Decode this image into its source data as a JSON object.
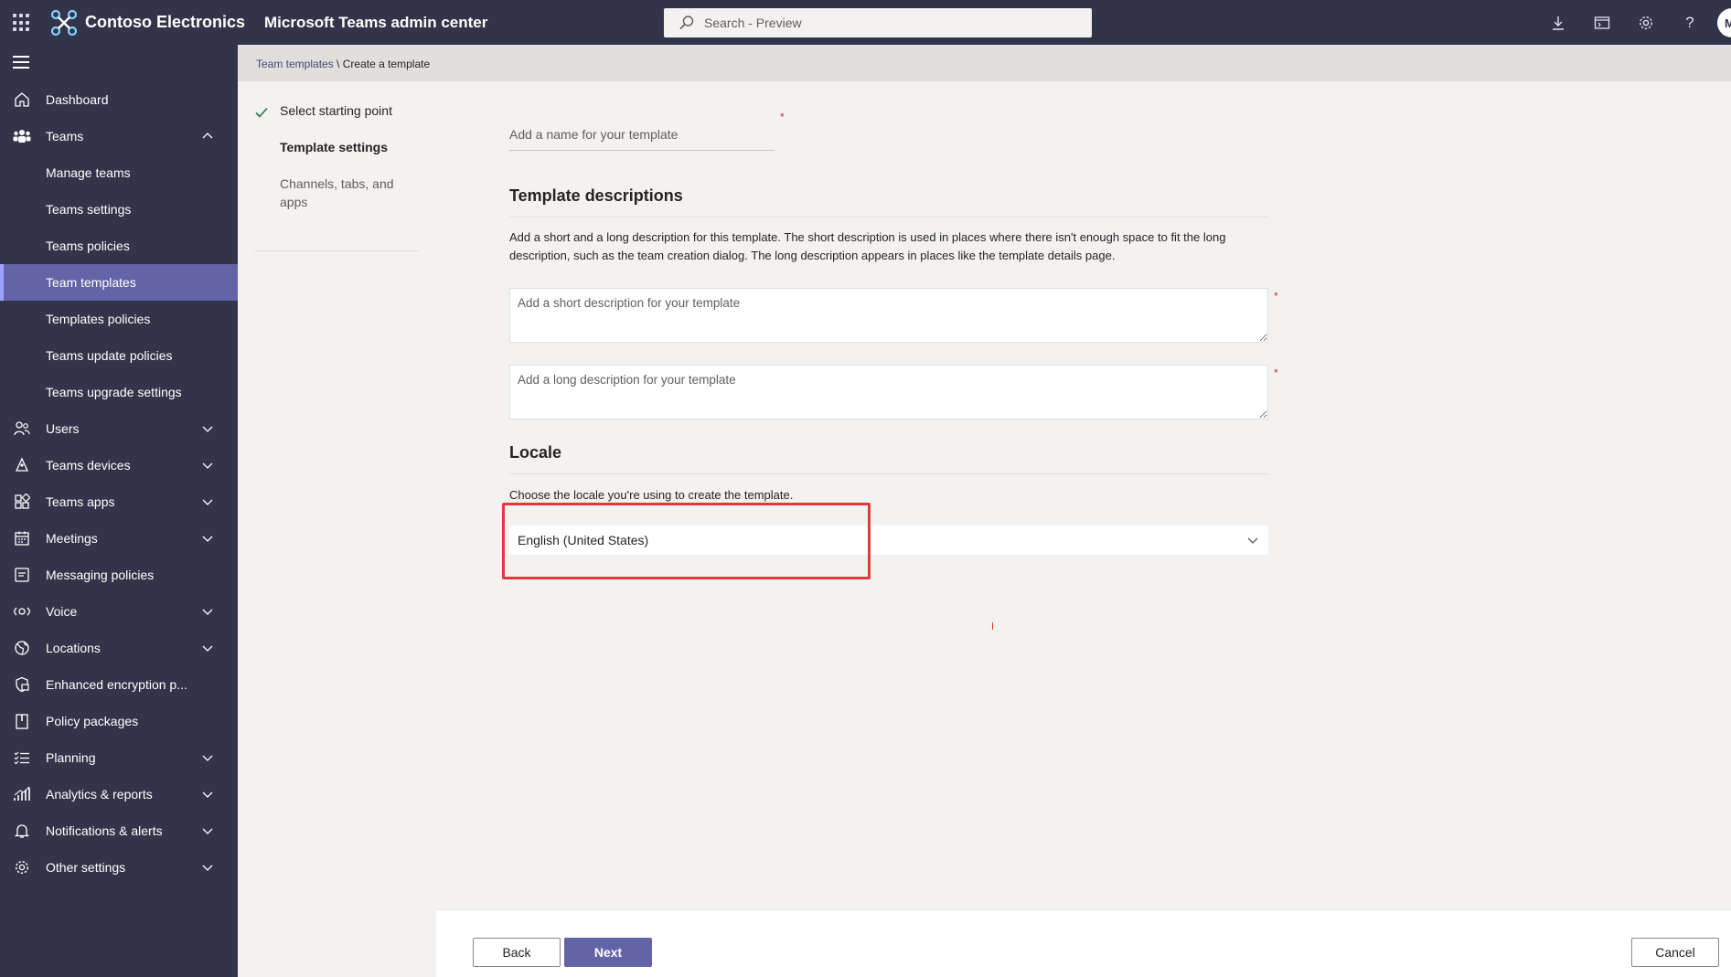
{
  "topbar": {
    "org_name": "Contoso Electronics",
    "app_title": "Microsoft Teams admin center",
    "search_placeholder": "Search - Preview",
    "avatar_initial": "M"
  },
  "breadcrumb": {
    "parent": "Team templates",
    "separator": "\\",
    "current": "Create a template"
  },
  "nav": {
    "items": [
      {
        "label": "Dashboard",
        "icon": "home-icon"
      },
      {
        "label": "Teams",
        "icon": "teams-icon",
        "expanded": true
      },
      {
        "label": "Manage teams"
      },
      {
        "label": "Teams settings"
      },
      {
        "label": "Teams policies"
      },
      {
        "label": "Team templates",
        "active": true
      },
      {
        "label": "Templates policies"
      },
      {
        "label": "Teams update policies"
      },
      {
        "label": "Teams upgrade settings"
      },
      {
        "label": "Users",
        "icon": "users-icon"
      },
      {
        "label": "Teams devices",
        "icon": "devices-icon"
      },
      {
        "label": "Teams apps",
        "icon": "apps-icon"
      },
      {
        "label": "Meetings",
        "icon": "calendar-icon"
      },
      {
        "label": "Messaging policies",
        "icon": "message-icon"
      },
      {
        "label": "Voice",
        "icon": "voice-icon"
      },
      {
        "label": "Locations",
        "icon": "globe-icon"
      },
      {
        "label": "Enhanced encryption p...",
        "icon": "lock-icon"
      },
      {
        "label": "Policy packages",
        "icon": "package-icon"
      },
      {
        "label": "Planning",
        "icon": "checklist-icon"
      },
      {
        "label": "Analytics & reports",
        "icon": "chart-icon"
      },
      {
        "label": "Notifications & alerts",
        "icon": "bell-icon"
      },
      {
        "label": "Other settings",
        "icon": "gear-icon"
      }
    ]
  },
  "steps": {
    "items": [
      {
        "label": "Select starting point",
        "state": "done"
      },
      {
        "label": "Template settings",
        "state": "current"
      },
      {
        "label": "Channels, tabs, and apps",
        "state": "upcoming"
      }
    ]
  },
  "form": {
    "name_placeholder": "Add a name for your template",
    "required_mark": "*",
    "descriptions_title": "Template descriptions",
    "descriptions_help": "Add a short and a long description for this template. The short description is used in places where there isn't enough space to fit the long description, such as the team creation dialog. The long description appears in places like the template details page.",
    "short_placeholder": "Add a short description for your template",
    "long_placeholder": "Add a long description for your template",
    "locale_title": "Locale",
    "locale_help": "Choose the locale you're using to create the template.",
    "locale_value": "English (United States)"
  },
  "footer": {
    "back_label": "Back",
    "next_label": "Next",
    "cancel_label": "Cancel"
  },
  "colors": {
    "header": "#33344a",
    "accent": "#6264a7",
    "highlight": "#e03a3a"
  }
}
